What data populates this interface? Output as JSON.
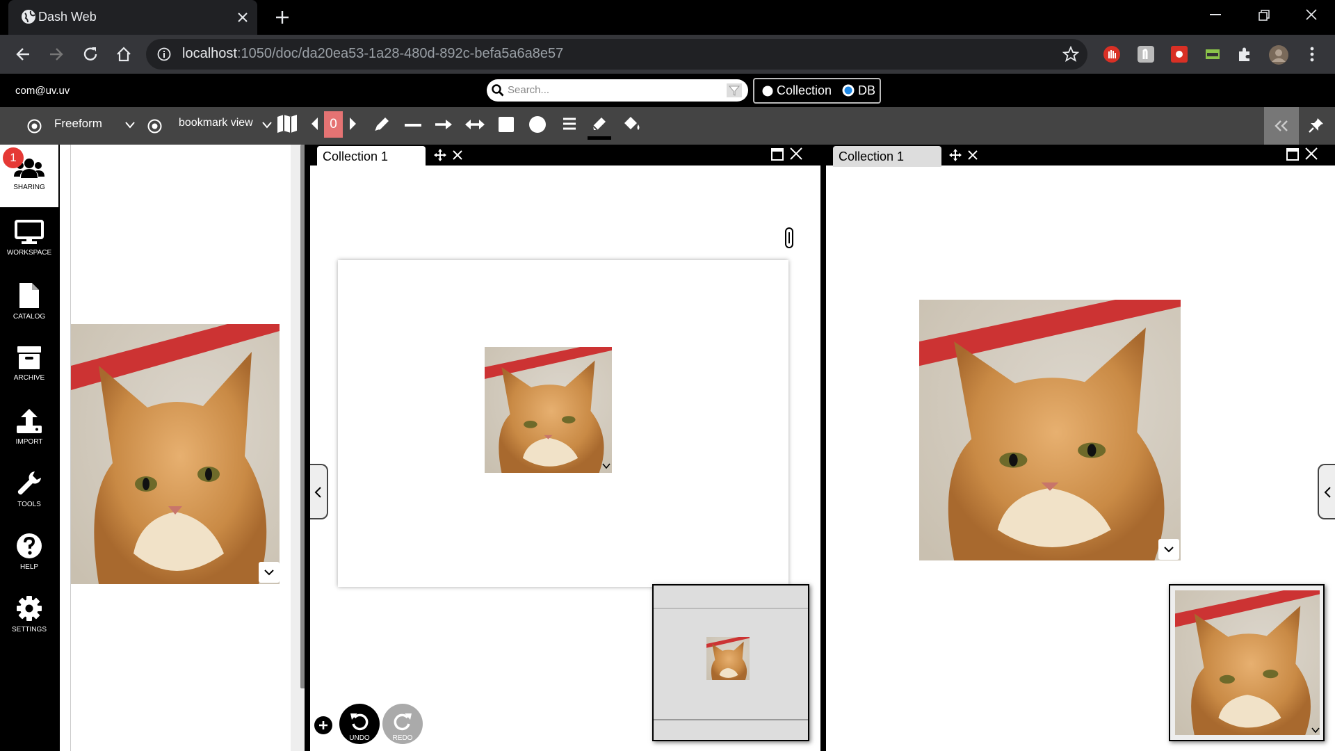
{
  "browser": {
    "tab_title": "Dash Web",
    "url_host": "localhost",
    "url_path": ":1050/doc/da20ea53-1a28-480d-892c-befa5a6a8e57"
  },
  "header": {
    "user": "com@uv.uv",
    "search_placeholder": "Search...",
    "scope_options": [
      "Collection",
      "DB"
    ],
    "scope_selected": "DB"
  },
  "toolbar": {
    "view_mode": "Freeform",
    "bookmark_view": "bookmark view",
    "counter": "0"
  },
  "sidebar": {
    "sharing_badge": "1",
    "items": [
      {
        "label": "SHARING",
        "icon": "users-icon"
      },
      {
        "label": "WORKSPACE",
        "icon": "monitor-icon"
      },
      {
        "label": "CATALOG",
        "icon": "file-icon"
      },
      {
        "label": "ARCHIVE",
        "icon": "archive-icon"
      },
      {
        "label": "IMPORT",
        "icon": "upload-icon"
      },
      {
        "label": "TOOLS",
        "icon": "wrench-icon"
      },
      {
        "label": "HELP",
        "icon": "help-icon"
      },
      {
        "label": "SETTINGS",
        "icon": "gear-icon"
      }
    ]
  },
  "panes": {
    "left_tab": "Collection 1",
    "right_tab": "Collection 1"
  },
  "history": {
    "undo_label": "UNDO",
    "redo_label": "REDO"
  },
  "colors": {
    "badge_red": "#e53935",
    "counter_bg": "#e57373",
    "scope_radio": "#1e88e5"
  }
}
